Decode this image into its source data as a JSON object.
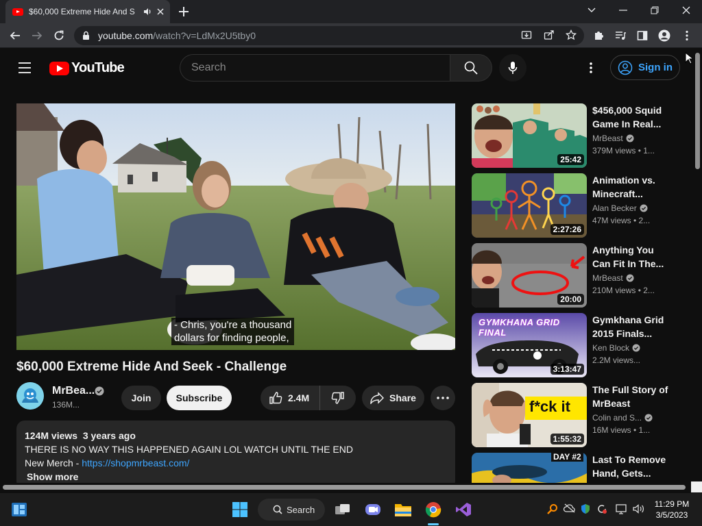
{
  "browser": {
    "tab_title": "$60,000 Extreme Hide And S",
    "url_host": "youtube.com",
    "url_path": "/watch?v=LdMx2U5tby0"
  },
  "yt": {
    "logo_text": "YouTube",
    "search_placeholder": "Search",
    "signin_label": "Sign in"
  },
  "video": {
    "caption_line1": "- Chris, you're a thousand",
    "caption_line2": "dollars for finding people,",
    "title": "$60,000 Extreme Hide And Seek - Challenge",
    "channel": "MrBea...",
    "subscribers": "136M...",
    "join_label": "Join",
    "subscribe_label": "Subscribe",
    "likes": "2.4M",
    "share_label": "Share"
  },
  "description": {
    "stats": "124M views  3 years ago",
    "line1": "THERE IS NO WAY THIS HAPPENED AGAIN LOL WATCH UNTIL THE END",
    "merch_prefix": "New Merch - ",
    "merch_link": "https://shopmrbeast.com/",
    "show_more": "Show more"
  },
  "recommendations": [
    {
      "title": "$456,000 Squid Game In Real...",
      "channel": "MrBeast",
      "verified": true,
      "meta": "379M views  • 1...",
      "duration": "25:42"
    },
    {
      "title": "Animation vs. Minecraft...",
      "channel": "Alan Becker",
      "verified": true,
      "meta": "47M views  • 2...",
      "duration": "2:27:26"
    },
    {
      "title": "Anything You Can Fit In The...",
      "channel": "MrBeast",
      "verified": true,
      "meta": "210M views  • 2...",
      "duration": "20:00"
    },
    {
      "title": "Gymkhana Grid 2015 Finals...",
      "channel": "Ken Block",
      "verified": true,
      "meta": "2.2M views...",
      "duration": "3:13:47",
      "thumb_text": "GYMKHANA GRID FINAL"
    },
    {
      "title": "The Full Story of MrBeast",
      "channel": "Colin and S...",
      "verified": true,
      "meta": "16M views  • 1...",
      "duration": "1:55:32",
      "thumb_text": "f*ck it"
    },
    {
      "title": "Last To Remove Hand, Gets...",
      "channel": "",
      "verified": false,
      "meta": "",
      "duration": "",
      "thumb_text": "DAY #2"
    }
  ],
  "taskbar": {
    "search_label": "Search",
    "time": "11:29 PM",
    "date": "3/5/2023"
  }
}
